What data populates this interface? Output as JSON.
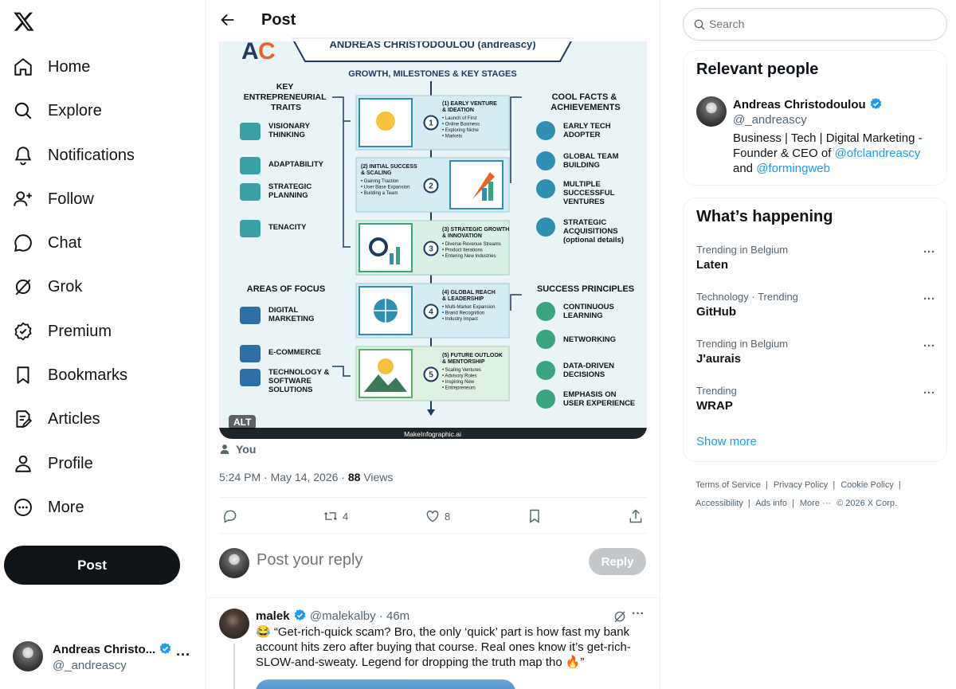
{
  "nav": {
    "items": [
      {
        "label": "Home",
        "icon": "home-icon"
      },
      {
        "label": "Explore",
        "icon": "search-icon"
      },
      {
        "label": "Notifications",
        "icon": "bell-icon"
      },
      {
        "label": "Follow",
        "icon": "add-user-icon"
      },
      {
        "label": "Chat",
        "icon": "chat-icon"
      },
      {
        "label": "Grok",
        "icon": "grok-icon"
      },
      {
        "label": "Premium",
        "icon": "premium-icon"
      },
      {
        "label": "Bookmarks",
        "icon": "bookmark-icon"
      },
      {
        "label": "Articles",
        "icon": "article-icon"
      },
      {
        "label": "Profile",
        "icon": "user-icon"
      },
      {
        "label": "More",
        "icon": "more-circle-icon"
      }
    ],
    "post_label": "Post",
    "account": {
      "name": "Andreas Christo...",
      "handle": "@_andreascy"
    }
  },
  "post": {
    "header_title": "Post",
    "alt_badge": "ALT",
    "attribution": "You",
    "time": "5:24 PM · May 14, 2026 · ",
    "views_count": "88",
    "views_label": " Views",
    "retweets": "4",
    "likes": "8"
  },
  "infographic": {
    "title": "ANDREAS CHRISTODOULOU (andreascy)",
    "subtitle": "GROWTH, MILESTONES & KEY STAGES",
    "left_heading_1": [
      "KEY",
      "ENTREPRENEURIAL",
      "TRAITS"
    ],
    "traits": [
      [
        "VISIONARY",
        "THINKING"
      ],
      [
        "ADAPTABILITY"
      ],
      [
        "STRATEGIC",
        "PLANNING"
      ],
      [
        "TENACITY"
      ]
    ],
    "left_heading_2": "AREAS OF FOCUS",
    "focus": [
      [
        "DIGITAL",
        "MARKETING"
      ],
      [
        "E-COMMERCE"
      ],
      [
        "TECHNOLOGY &",
        "SOFTWARE",
        "SOLUTIONS"
      ]
    ],
    "right_heading_1": [
      "COOL FACTS &",
      "ACHIEVEMENTS"
    ],
    "facts": [
      [
        "EARLY TECH",
        "ADOPTER"
      ],
      [
        "GLOBAL TEAM",
        "BUILDING"
      ],
      [
        "MULTIPLE",
        "SUCCESSFUL",
        "VENTURES"
      ],
      [
        "STRATEGIC",
        "ACQUISITIONS",
        "(optional details)"
      ]
    ],
    "right_heading_2": "SUCCESS PRINCIPLES",
    "principles": [
      [
        "CONTINUOUS",
        "LEARNING"
      ],
      [
        "NETWORKING"
      ],
      [
        "DATA-DRIVEN",
        "DECISIONS"
      ],
      [
        "EMPHASIS ON",
        "USER EXPERIENCE"
      ]
    ],
    "stages": [
      {
        "num": "1",
        "title": [
          "(1) EARLY VENTURE",
          "& IDEATION"
        ],
        "bullets": [
          "Launch of First",
          "Online Business",
          "Exploring Niche",
          "Markets"
        ]
      },
      {
        "num": "2",
        "title": [
          "(2) INITIAL SUCCESS",
          "& SCALING"
        ],
        "bullets": [
          "Gaining Traction",
          "User Base Expansion",
          "Building a Team"
        ]
      },
      {
        "num": "3",
        "title": [
          "(3) STRATEGIC GROWTH",
          "& INNOVATION"
        ],
        "bullets": [
          "Diverse Revenue Streams",
          "Product Iterations",
          "Entering New Industries"
        ]
      },
      {
        "num": "4",
        "title": [
          "(4) GLOBAL REACH",
          "& LEADERSHIP"
        ],
        "bullets": [
          "Multi-Market Expansion",
          "Brand Recognition",
          "Industry Impact"
        ]
      },
      {
        "num": "5",
        "title": [
          "(5) FUTURE OUTLOOK",
          "& MENTORSHIP"
        ],
        "bullets": [
          "Scaling Ventures",
          "Advisory Roles",
          "Inspiring New",
          "Entrepreneurs"
        ]
      }
    ],
    "watermark": "MakeInfographic.ai"
  },
  "reply": {
    "placeholder": "Post your reply",
    "button": "Reply"
  },
  "comment": {
    "name": "malek",
    "handle": "@malekalby",
    "time": " · 46m",
    "text": "😂 “Get-rich-quick scam? Bro, the only ‘quick’ part is how fast my bank account hits zero after buying that course. Real ones know it’s get-rich-SLOW-and-sweaty. Legend for dropping the truth map tho 🔥”"
  },
  "sidebar": {
    "search_placeholder": "Search",
    "relevant_title": "Relevant people",
    "person": {
      "name": "Andreas Christodoulou",
      "handle": "@_andreascy",
      "bio_text": "Business | Tech | Digital Marketing - Founder & CEO of ",
      "bio_link_1": "@ofclandreascy",
      "bio_mid": " and ",
      "bio_link_2": "@formingweb"
    },
    "happening_title": "What’s happening",
    "trends": [
      {
        "meta": "Trending in Belgium",
        "name": "Laten"
      },
      {
        "meta": "Technology · Trending",
        "name": "GitHub"
      },
      {
        "meta": "Trending in Belgium",
        "name": "J'aurais"
      },
      {
        "meta": "Trending",
        "name": "WRAP"
      }
    ],
    "show_more": "Show more",
    "footer": [
      "Terms of Service",
      "Privacy Policy",
      "Cookie Policy",
      "Accessibility",
      "Ads info",
      "More ···",
      "© 2026 X Corp."
    ]
  },
  "colors": {
    "accent": "#1d9bf0",
    "text": "#0f1419",
    "muted": "#536471",
    "infographic_line": "#1e3a5f"
  }
}
